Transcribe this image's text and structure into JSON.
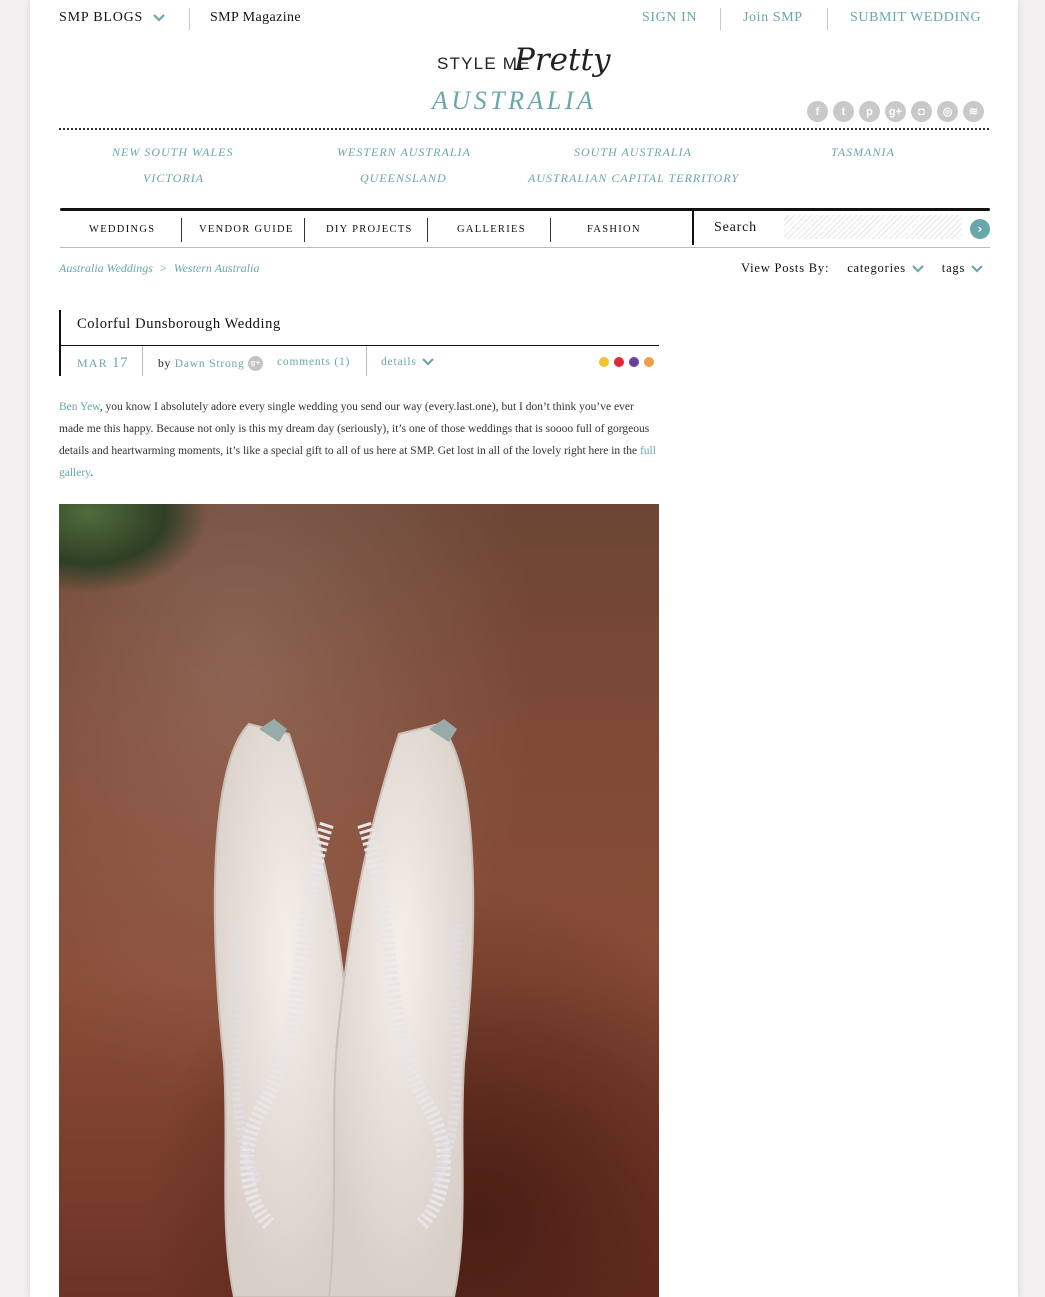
{
  "header": {
    "smp_blogs": "SMP BLOGS",
    "smp_magazine": "SMP Magazine",
    "sign_in": "SIGN IN",
    "join": "Join SMP",
    "submit": "SUBMIT WEDDING"
  },
  "logo": {
    "top": "STYLE ME",
    "script": "Pretty",
    "bottom": "AUSTRALIA"
  },
  "social": [
    "facebook-icon",
    "twitter-icon",
    "pinterest-icon",
    "google-plus-icon",
    "instagram-icon",
    "vimeo-icon",
    "rss-icon"
  ],
  "regions": [
    "NEW SOUTH WALES",
    "WESTERN AUSTRALIA",
    "SOUTH AUSTRALIA",
    "TASMANIA",
    "VICTORIA",
    "QUEENSLAND",
    "AUSTRALIAN CAPITAL TERRITORY"
  ],
  "nav": [
    "WEDDINGS",
    "VENDOR GUIDE",
    "DIY PROJECTS",
    "GALLERIES",
    "FASHION"
  ],
  "search": {
    "label": "Search",
    "placeholder": ""
  },
  "breadcrumb": [
    "Australia Weddings",
    ">",
    "Western Australia"
  ],
  "view_posts": {
    "label": "View Posts By:",
    "categories": "categories",
    "tags": "tags"
  },
  "post": {
    "title": "Colorful Dunsborough Wedding",
    "month": "MAR",
    "day": "17",
    "by": "by",
    "author": "Dawn Strong",
    "comments": "comments (1)",
    "details": "details",
    "colors": [
      "#f0c330",
      "#e0283a",
      "#6b3fa0",
      "#f29d48"
    ],
    "body_link1": "Ben Yew",
    "body_text": ", you know I absolutely adore every single wedding you send our way (every.last.one), but I don’t think you’ve ever made me this happy.  Because not only is this my dream day (seriously), it’s one of those weddings that is soooo full of gorgeous details and heartwarming moments, it’s like a special gift to all of us here at SMP.  Get lost in all of the lovely right here in the ",
    "body_link2": "full gallery",
    "body_end": "."
  },
  "accent_color": "#6aa7ad"
}
